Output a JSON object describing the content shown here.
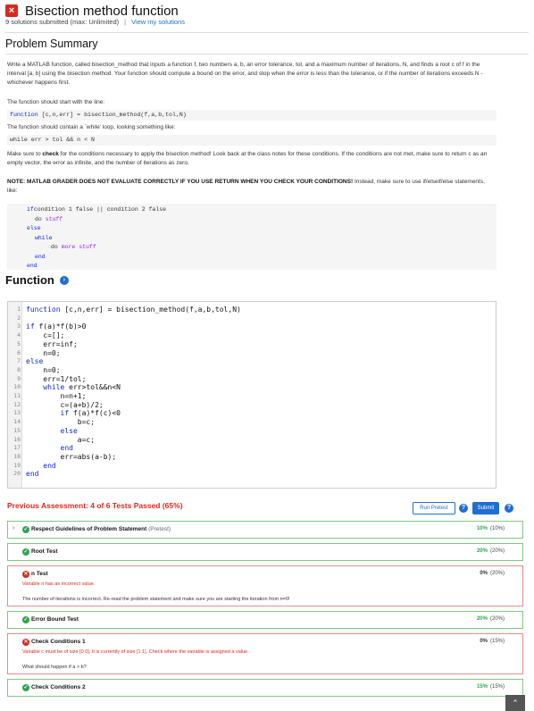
{
  "header": {
    "title": "Bisection method function",
    "submitted": "9 solutions submitted (max: Unlimited)",
    "separator": "|",
    "view_link": "View my solutions"
  },
  "summary": {
    "heading": "Problem Summary",
    "p1": "Write a MATLAB function, called bisection_method that inputs a function f, two numbers a, b, an error tolerance, tol, and a maximum number of iterations, N, and finds a root c of f in the interval [a, b] using the bisection method. Your function should compute a bound on the error, and stop when the error is less than the tolerance, or if the number of iterations exceeds N - whichever happens first.",
    "p2": "The function should start with the line:",
    "code1_kw": "function",
    "code1_rest": " [c,n,err] = bisection_method(f,a,b,tol,N)",
    "p3": "The function should contain a `while' loop, looking something like:",
    "code2": "while err > tol && n < N",
    "p4_a": "Make sure to ",
    "p4_b": "check",
    "p4_c": " for the conditions necessary to apply the bisection method! Look back at the class notes for these conditions. If the conditions are not met, make sure to return c as an empty vector, the error as infinite, and the number of iterations as zero.",
    "p5_bold": "NOTE: MATLAB GRADER DOES NOT EVALUATE CORRECTLY IF YOU USE RETURN WHEN YOU  CHECK YOUR CONDITIONS!",
    "p5_rest": " Instead, make sure to use if/elseif/else statements, like:",
    "pre_lines": [
      {
        "indent": 0,
        "parts": [
          [
            "kw",
            "if"
          ],
          [
            "",
            "condition 1 false || condition 2 false"
          ]
        ]
      },
      {
        "indent": 2,
        "parts": [
          [
            "",
            "do "
          ],
          [
            "str",
            "stuff"
          ]
        ]
      },
      {
        "indent": 0,
        "parts": [
          [
            "kw",
            "else"
          ]
        ]
      },
      {
        "indent": 2,
        "parts": [
          [
            "kw",
            "while"
          ]
        ]
      },
      {
        "indent": 6,
        "parts": [
          [
            "",
            "do "
          ],
          [
            "str",
            "more stuff"
          ]
        ]
      },
      {
        "indent": 2,
        "parts": [
          [
            "kw",
            "end"
          ]
        ]
      },
      {
        "indent": 0,
        "parts": [
          [
            "kw",
            "end"
          ]
        ]
      }
    ]
  },
  "function_section": {
    "heading": "Function",
    "code": [
      {
        "n": "1",
        "t": [
          [
            "kw",
            "function"
          ],
          [
            "",
            " [c,n,err] = bisection_method(f,a,b,tol,N)"
          ]
        ]
      },
      {
        "n": "2",
        "t": []
      },
      {
        "n": "3",
        "t": [
          [
            "kw",
            "if"
          ],
          [
            "",
            " f(a)*f(b)>0"
          ]
        ]
      },
      {
        "n": "4",
        "t": [
          [
            "",
            "    c=[];"
          ]
        ]
      },
      {
        "n": "5",
        "t": [
          [
            "",
            "    err=inf;"
          ]
        ]
      },
      {
        "n": "6",
        "t": [
          [
            "",
            "    n=0;"
          ]
        ]
      },
      {
        "n": "7",
        "t": [
          [
            "kw",
            "else"
          ]
        ]
      },
      {
        "n": "8",
        "t": [
          [
            "",
            "    n=0;"
          ]
        ]
      },
      {
        "n": "9",
        "t": [
          [
            "",
            "    err=1/tol;"
          ]
        ]
      },
      {
        "n": "10",
        "t": [
          [
            "",
            "    "
          ],
          [
            "kw",
            "while"
          ],
          [
            "",
            " err>tol&&n<N"
          ]
        ]
      },
      {
        "n": "11",
        "t": [
          [
            "",
            "        n=n+1;"
          ]
        ]
      },
      {
        "n": "12",
        "t": [
          [
            "",
            "        c=(a+b)/2;"
          ]
        ]
      },
      {
        "n": "13",
        "t": [
          [
            "",
            "        "
          ],
          [
            "kw",
            "if"
          ],
          [
            "",
            " f(a)*f(c)<0"
          ]
        ]
      },
      {
        "n": "14",
        "t": [
          [
            "",
            "            b=c;"
          ]
        ]
      },
      {
        "n": "15",
        "t": [
          [
            "",
            "        "
          ],
          [
            "kw",
            "else"
          ]
        ]
      },
      {
        "n": "16",
        "t": [
          [
            "",
            "            a=c;"
          ]
        ]
      },
      {
        "n": "17",
        "t": [
          [
            "",
            "        "
          ],
          [
            "kw",
            "end"
          ]
        ]
      },
      {
        "n": "18",
        "t": [
          [
            "",
            "        err=abs(a-b);"
          ]
        ]
      },
      {
        "n": "19",
        "t": [
          [
            "",
            "    "
          ],
          [
            "kw",
            "end"
          ]
        ]
      },
      {
        "n": "20",
        "t": [
          [
            "kw",
            "end"
          ]
        ]
      }
    ]
  },
  "assessment": {
    "heading": "Previous Assessment: 4 of 6 Tests Passed (65%)",
    "run_pretest": "Run Pretest",
    "submit": "Submit",
    "tests": [
      {
        "name": "Respect Guidelines of Problem Statement",
        "tag": "(Pretest)",
        "status": "pass",
        "score": "10%",
        "weight": "(10%)",
        "chevron": true
      },
      {
        "name": "Root Test",
        "tag": "",
        "status": "pass",
        "score": "20%",
        "weight": "(20%)"
      },
      {
        "name": "n Test",
        "tag": "",
        "status": "fail",
        "score": "0%",
        "weight": "(20%)",
        "error": "Variable n has an incorrect value.",
        "message": "The number of iterations is incorrect. Re-read the problem statement and make sure you are starting the iteration from n=0!"
      },
      {
        "name": "Error Bound Test",
        "tag": "",
        "status": "pass",
        "score": "20%",
        "weight": "(20%)"
      },
      {
        "name": "Check Conditions 1",
        "tag": "",
        "status": "fail",
        "score": "0%",
        "weight": "(15%)",
        "error": "Variable c must be of size [0 0]. It is currently of size [1 1]. Check where the variable is assigned a value.",
        "message": "What should happen if a > b?"
      },
      {
        "name": "Check Conditions 2",
        "tag": "",
        "status": "pass",
        "score": "15%",
        "weight": "(15%)"
      }
    ]
  },
  "colors": {
    "accent": "#1f6fd0",
    "error": "#d9281e",
    "pass": "#2ea44f",
    "keyword": "#0b29d8",
    "string": "#a020f0"
  }
}
